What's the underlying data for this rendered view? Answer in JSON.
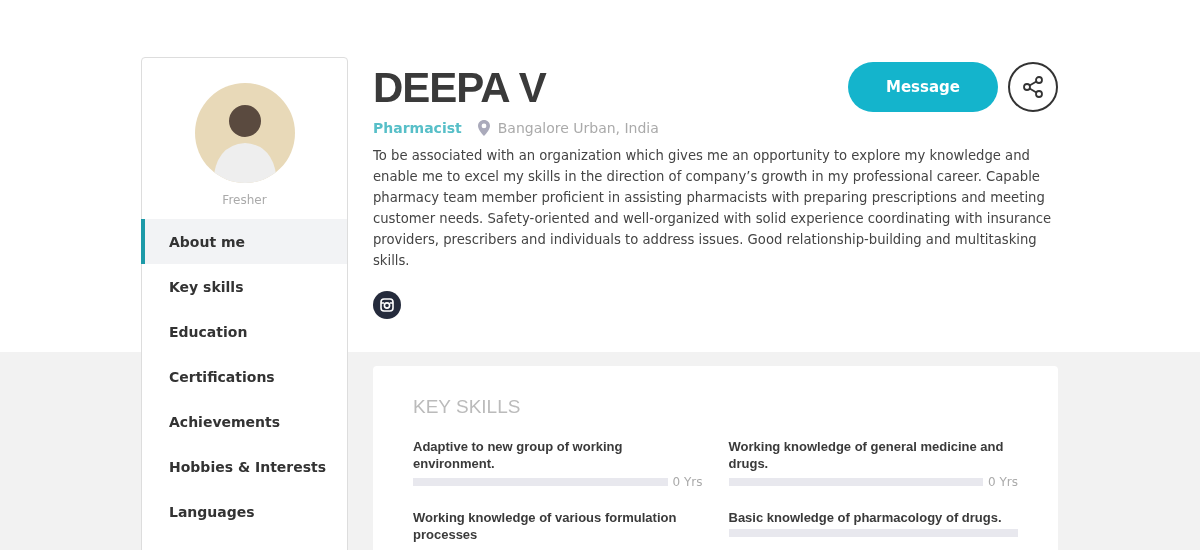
{
  "profile": {
    "experience": "Fresher",
    "name": "DEEPA V",
    "role": "Pharmacist",
    "location": "Bangalore Urban, India",
    "summary": "To be associated with an organization which gives me an opportunity to explore my knowledge and enable me to excel my skills in the direction of company’s growth in my professional career. Capable pharmacy team member proficient in assisting pharmacists with preparing prescriptions and meeting customer needs. Safety-oriented and well-organized with solid experience coordinating with insurance providers, prescribers and individuals to address issues. Good relationship-building and multitasking skills."
  },
  "actions": {
    "message_button": "Message"
  },
  "sidebar": {
    "items": [
      {
        "label": "About me",
        "selected": true
      },
      {
        "label": "Key skills",
        "selected": false
      },
      {
        "label": "Education",
        "selected": false
      },
      {
        "label": "Certifications",
        "selected": false
      },
      {
        "label": "Achievements",
        "selected": false
      },
      {
        "label": "Hobbies & Interests",
        "selected": false
      },
      {
        "label": "Languages",
        "selected": false
      }
    ]
  },
  "key_skills": {
    "title": "KEY SKILLS",
    "skills": [
      {
        "name": "Adaptive to new group of working environment.",
        "level": 0,
        "years": "0 Yrs"
      },
      {
        "name": "Working knowledge of general medicine and drugs.",
        "level": 0,
        "years": "0 Yrs"
      },
      {
        "name": "Working knowledge of various formulation processes"
      },
      {
        "name": "Basic knowledge of pharmacology of drugs.",
        "level": 0
      }
    ]
  }
}
